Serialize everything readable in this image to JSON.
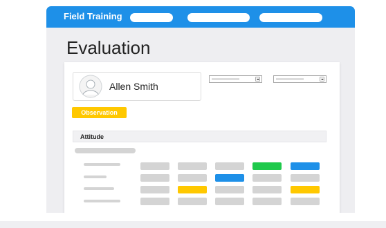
{
  "app": {
    "title": "Field Training",
    "nav_pill_count": 3
  },
  "page": {
    "title": "Evaluation"
  },
  "user": {
    "name": "Allen Smith",
    "avatar_icon": "user-avatar-icon"
  },
  "filters": {
    "icon": "chevron-down-icon",
    "count": 2
  },
  "badge": {
    "label": "Observation",
    "color": "#ffc800"
  },
  "section": {
    "title": "Attitude"
  },
  "colors": {
    "brand": "#1e90e8",
    "neutral": "#d4d4d4",
    "success": "#1fc94b",
    "info": "#1e90e8",
    "warning": "#ffc800"
  },
  "grid": {
    "rows": [
      [
        "neutral",
        "neutral",
        "neutral",
        "success",
        "info"
      ],
      [
        "neutral",
        "neutral",
        "info",
        "neutral",
        "neutral"
      ],
      [
        "neutral",
        "warning",
        "neutral",
        "neutral",
        "warning"
      ],
      [
        "neutral",
        "neutral",
        "neutral",
        "neutral",
        "neutral"
      ]
    ]
  }
}
